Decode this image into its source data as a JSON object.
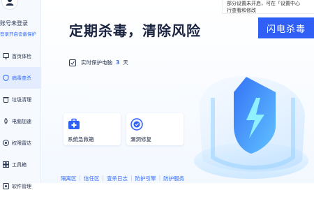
{
  "account": {
    "title": "账号未登录",
    "subtitle": "登录开启设备保护"
  },
  "sidebar": {
    "items": [
      {
        "label": "首页体检",
        "icon": "monitor-icon"
      },
      {
        "label": "病毒查杀",
        "icon": "shield-icon",
        "active": true
      },
      {
        "label": "垃圾清理",
        "icon": "trash-icon"
      },
      {
        "label": "电脑加速",
        "icon": "rocket-icon"
      },
      {
        "label": "权限雷达",
        "icon": "radar-icon"
      },
      {
        "label": "工具箱",
        "icon": "toolbox-icon"
      },
      {
        "label": "软件管理",
        "icon": "apps-icon"
      }
    ]
  },
  "main": {
    "headline": "定期杀毒，清除风险",
    "scan_button": "闪电杀毒",
    "tooltip": {
      "line1": "部分设置未开启，可在「设置中心",
      "line2": "行查看和修改"
    },
    "protect": {
      "label": "实时保护电脑",
      "days": "3",
      "unit": "天"
    },
    "cards": [
      {
        "label": "系统急救箱",
        "icon": "first-aid-kit-icon"
      },
      {
        "label": "漏洞修复",
        "icon": "patch-repair-icon"
      }
    ],
    "footer_links": [
      "隔离区",
      "信任区",
      "查杀日志",
      "防护引擎",
      "防护服务"
    ]
  },
  "colors": {
    "accent": "#2f5ff5",
    "link": "#2f6bff",
    "active_bg": "#e3edff"
  }
}
